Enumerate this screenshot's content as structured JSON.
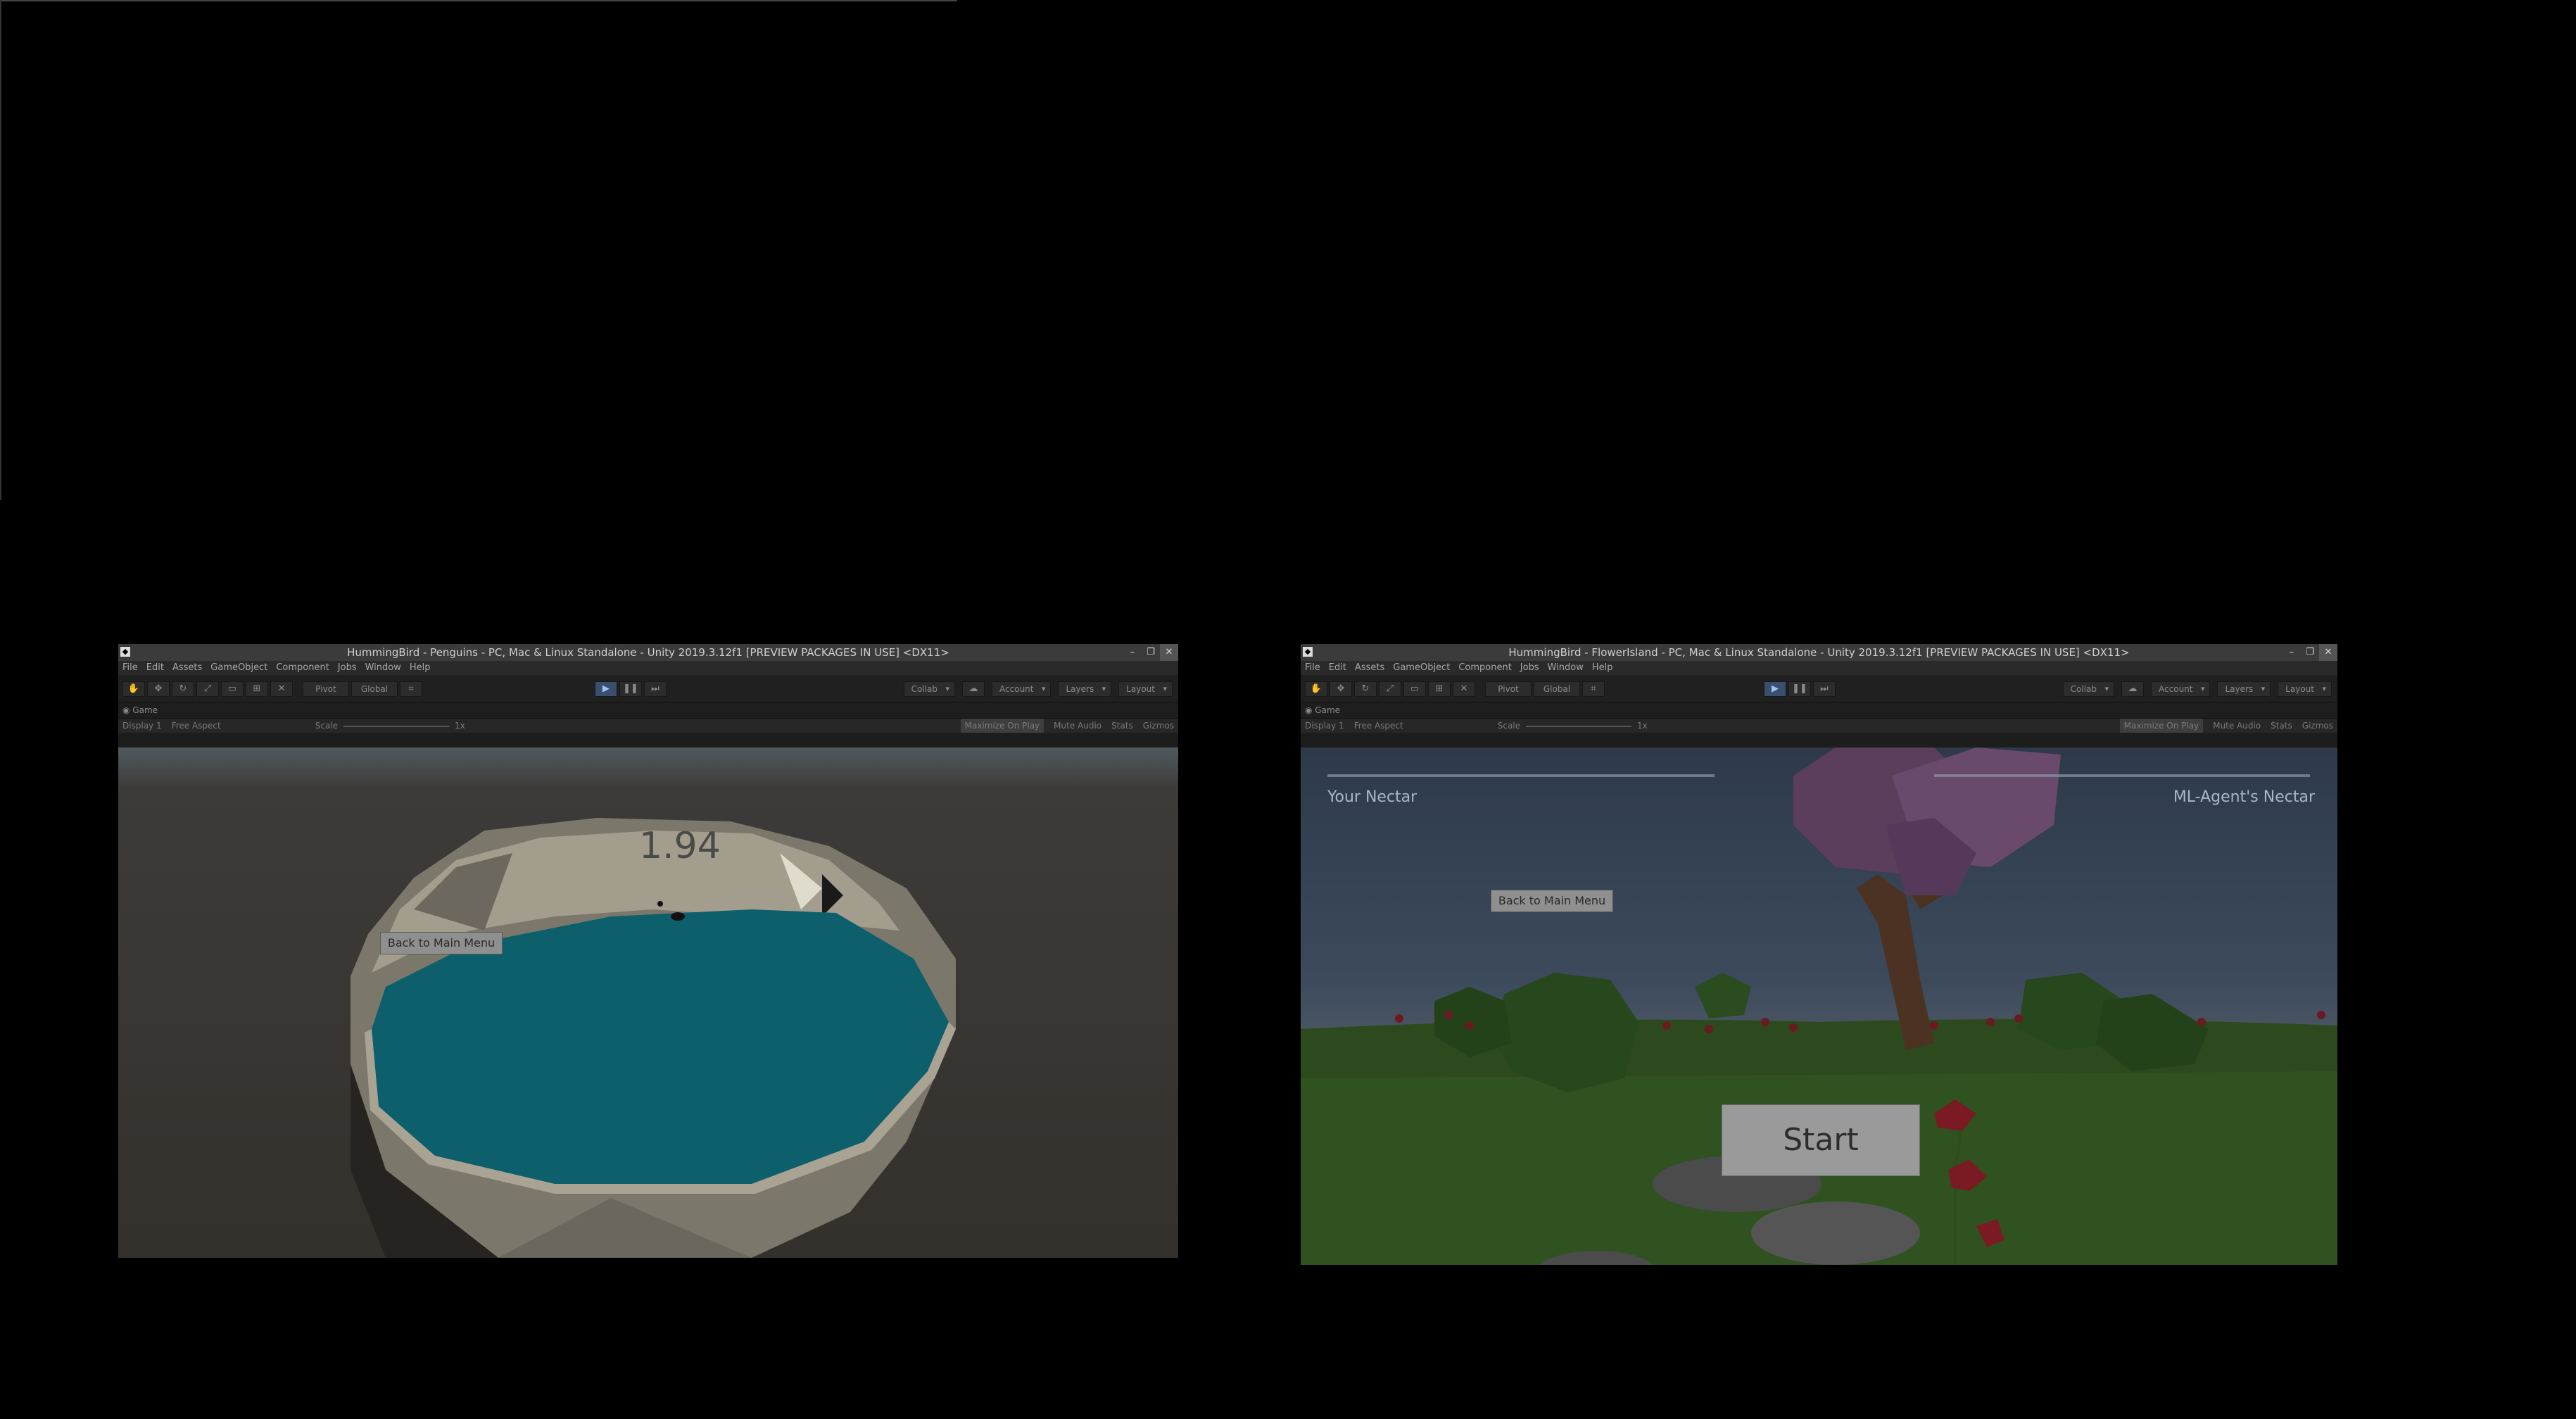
{
  "windows": [
    {
      "title": "HummingBird - Penguins - PC, Mac & Linux Standalone - Unity 2019.3.12f1 [PREVIEW PACKAGES IN USE] <DX11>",
      "menu": [
        "File",
        "Edit",
        "Assets",
        "GameObject",
        "Component",
        "Jobs",
        "Window",
        "Help"
      ],
      "toolbar": {
        "pivot": "Pivot",
        "global": "Global",
        "collab": "Collab",
        "account": "Account",
        "layers": "Layers",
        "layout": "Layout"
      },
      "tab": "Game",
      "gamebar": {
        "display": "Display 1",
        "aspect": "Free Aspect",
        "scale_label": "Scale",
        "scale_value": "1x",
        "maximize": "Maximize On Play",
        "mute": "Mute Audio",
        "stats": "Stats",
        "gizmos": "Gizmos"
      },
      "view": {
        "back_button": "Back to Main Menu",
        "score": "1.94"
      }
    },
    {
      "title": "HummingBird - FlowerIsland - PC, Mac & Linux Standalone - Unity 2019.3.12f1 [PREVIEW PACKAGES IN USE] <DX11>",
      "menu": [
        "File",
        "Edit",
        "Assets",
        "GameObject",
        "Component",
        "Jobs",
        "Window",
        "Help"
      ],
      "toolbar": {
        "pivot": "Pivot",
        "global": "Global",
        "collab": "Collab",
        "account": "Account",
        "layers": "Layers",
        "layout": "Layout"
      },
      "tab": "Game",
      "gamebar": {
        "display": "Display 1",
        "aspect": "Free Aspect",
        "scale_label": "Scale",
        "scale_value": "1x",
        "maximize": "Maximize On Play",
        "mute": "Mute Audio",
        "stats": "Stats",
        "gizmos": "Gizmos"
      },
      "view": {
        "your_nectar": "Your Nectar",
        "agent_nectar": "ML-Agent's Nectar",
        "back_button": "Back to Main Menu",
        "start_button": "Start"
      }
    }
  ]
}
